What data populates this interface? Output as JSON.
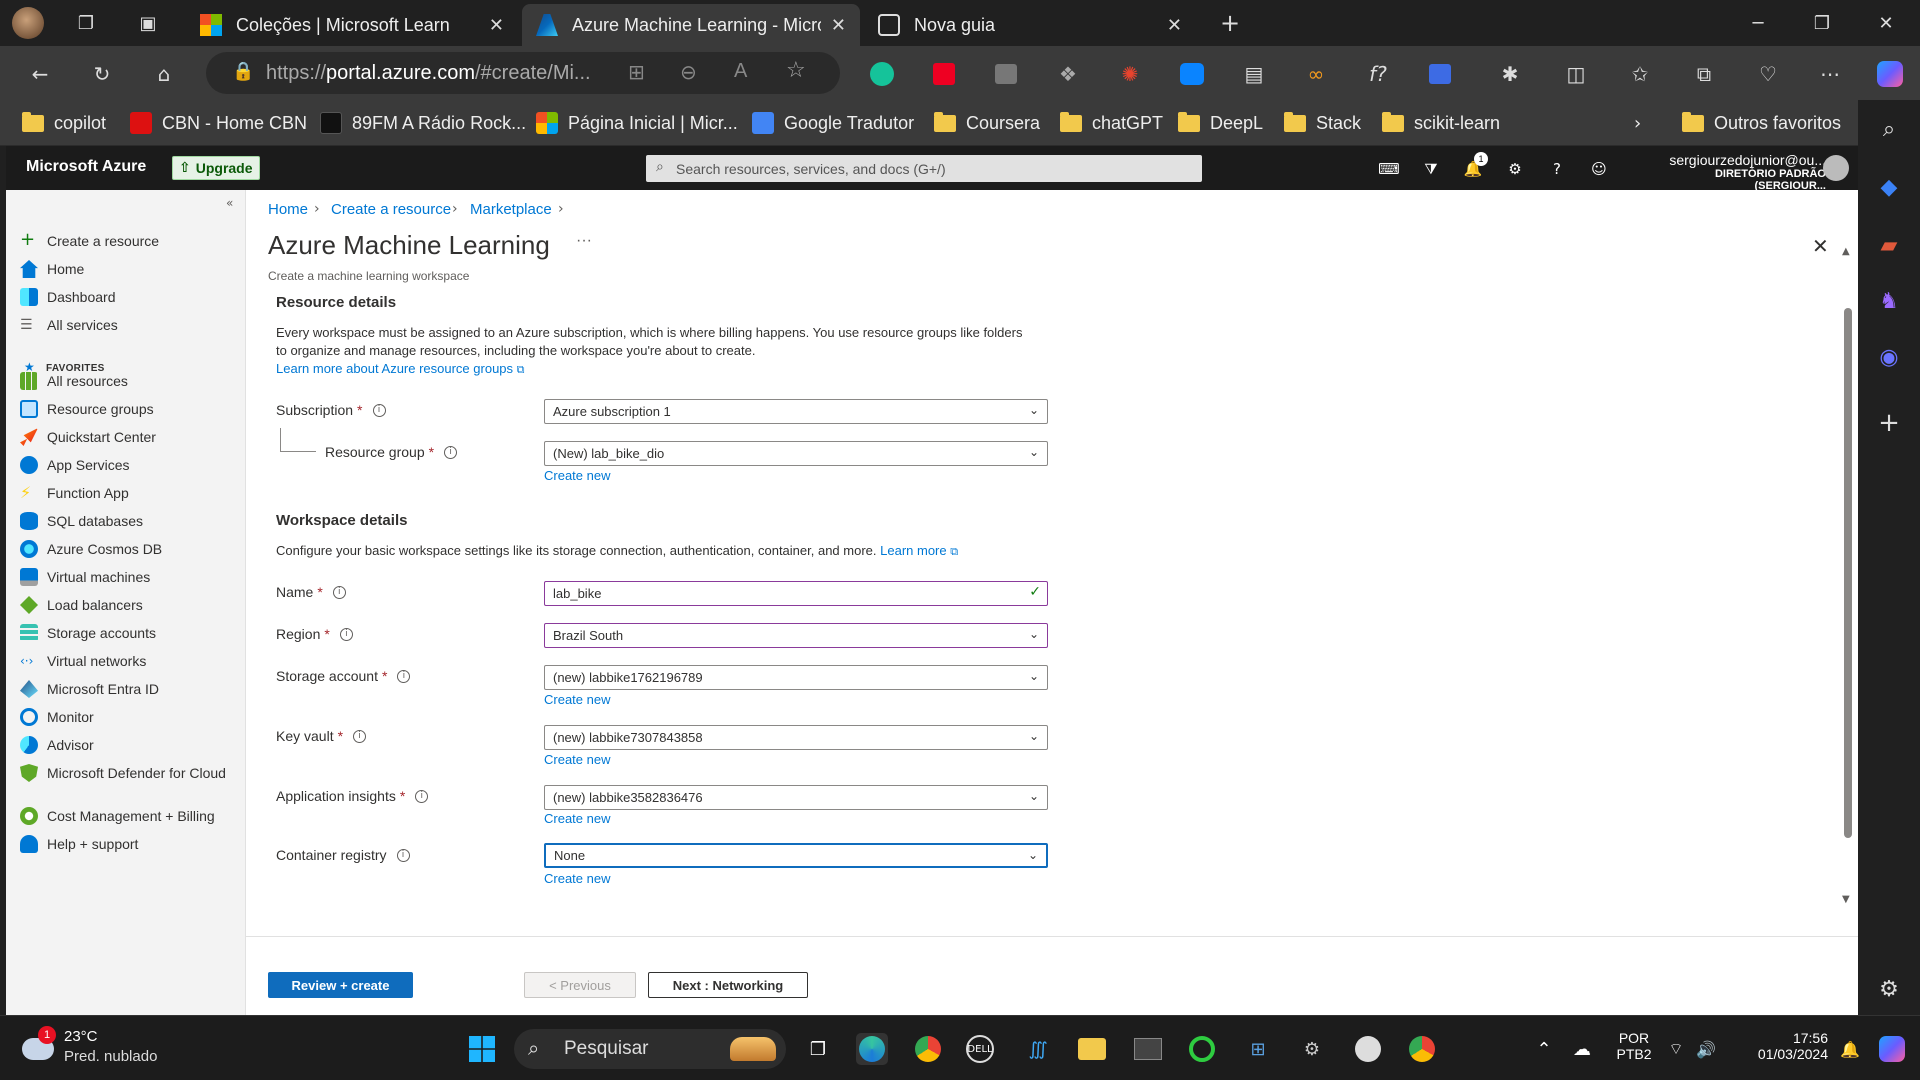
{
  "browser": {
    "tabs": [
      {
        "label": "Coleções | Microsoft Learn",
        "active": false
      },
      {
        "label": "Azure Machine Learning - Microsoft Azure",
        "active": true
      },
      {
        "label": "Nova guia",
        "active": false
      }
    ],
    "url_prefix": "https://",
    "url_host": "portal.azure.com",
    "url_rest": "/#create/Mi...",
    "favorites": [
      {
        "label": "copilot",
        "kind": "folder"
      },
      {
        "label": "CBN - Home CBN",
        "kind": "site"
      },
      {
        "label": "89FM A Rádio Rock...",
        "kind": "site"
      },
      {
        "label": "Página Inicial | Micr...",
        "kind": "site"
      },
      {
        "label": "Google Tradutor",
        "kind": "site"
      },
      {
        "label": "Coursera",
        "kind": "folder"
      },
      {
        "label": "chatGPT",
        "kind": "folder"
      },
      {
        "label": "DeepL",
        "kind": "folder"
      },
      {
        "label": "Stack",
        "kind": "folder"
      },
      {
        "label": "scikit-learn",
        "kind": "folder"
      },
      {
        "label": "Outros favoritos",
        "kind": "folder"
      }
    ]
  },
  "azure": {
    "brand": "Microsoft Azure",
    "upgrade": "Upgrade",
    "search_placeholder": "Search resources, services, and docs (G+/)",
    "notifications_count": "1",
    "user_email": "sergiourzedojunior@ou...",
    "user_directory": "DIRETÓRIO PADRÃO (SERGIOUR...",
    "nav": {
      "create": "Create a resource",
      "home": "Home",
      "dashboard": "Dashboard",
      "all_services": "All services",
      "favorites_header": "FAVORITES",
      "items": [
        "All resources",
        "Resource groups",
        "Quickstart Center",
        "App Services",
        "Function App",
        "SQL databases",
        "Azure Cosmos DB",
        "Virtual machines",
        "Load balancers",
        "Storage accounts",
        "Virtual networks",
        "Microsoft Entra ID",
        "Monitor",
        "Advisor",
        "Microsoft Defender for Cloud",
        "Cost Management + Billing",
        "Help + support"
      ]
    },
    "breadcrumb": [
      "Home",
      "Create a resource",
      "Marketplace"
    ],
    "title": "Azure Machine Learning",
    "subtitle": "Create a machine learning workspace",
    "resource_details": {
      "heading": "Resource details",
      "description": "Every workspace must be assigned to an Azure subscription, which is where billing happens. You use resource groups like folders to organize and manage resources, including the workspace you're about to create.",
      "learn_more": "Learn more about Azure resource groups",
      "subscription_label": "Subscription",
      "subscription_value": "Azure subscription 1",
      "resource_group_label": "Resource group",
      "resource_group_value": "(New) lab_bike_dio",
      "create_new": "Create new"
    },
    "workspace_details": {
      "heading": "Workspace details",
      "description": "Configure your basic workspace settings like its storage connection, authentication, container, and more.",
      "learn_more": "Learn more",
      "name_label": "Name",
      "name_value": "lab_bike",
      "region_label": "Region",
      "region_value": "Brazil South",
      "storage_label": "Storage account",
      "storage_value": "(new) labbike1762196789",
      "keyvault_label": "Key vault",
      "keyvault_value": "(new) labbike7307843858",
      "appinsights_label": "Application insights",
      "appinsights_value": "(new) labbike3582836476",
      "container_label": "Container registry",
      "container_value": "None",
      "create_new": "Create new"
    },
    "footer": {
      "review_create": "Review + create",
      "previous": "< Previous",
      "next": "Next : Networking"
    }
  },
  "taskbar": {
    "weather_badge": "1",
    "temperature": "23°C",
    "weather_desc": "Pred. nublado",
    "search": "Pesquisar",
    "lang1": "POR",
    "lang2": "PTB2",
    "time": "17:56",
    "date": "01/03/2024"
  }
}
